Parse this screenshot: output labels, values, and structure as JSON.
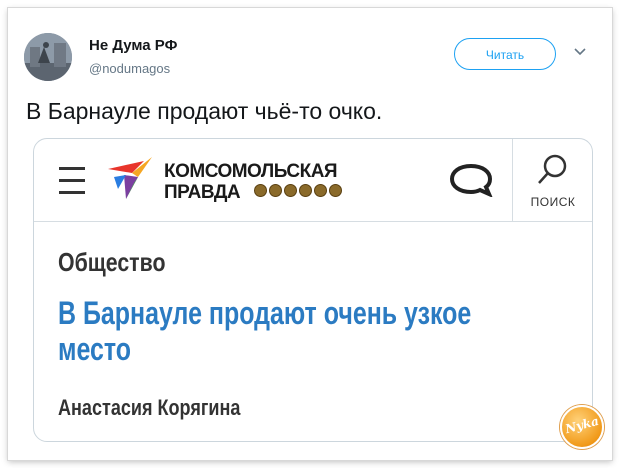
{
  "tweet": {
    "display_name": "Не Дума РФ",
    "handle": "@nodumagos",
    "follow_label": "Читать",
    "text": "В Барнауле продают чьё-то очко."
  },
  "card": {
    "logo_line1": "КОМСОМОЛЬСКАЯ",
    "logo_line2": "ПРАВДА",
    "search_label": "ПОИСК",
    "section": "Общество",
    "headline": "В Барнауле продают очень узкое место",
    "author": "Анастасия Корягина"
  },
  "watermark": {
    "text": "Nyka"
  },
  "colors": {
    "twitter_blue": "#1da1f2",
    "headline_blue": "#2b7bc2",
    "text_dark": "#14171a",
    "handle_gray": "#657786"
  },
  "icons": [
    "hamburger-menu-icon",
    "logo-bird-icon",
    "comment-icon",
    "search-icon",
    "chevron-down-icon"
  ]
}
